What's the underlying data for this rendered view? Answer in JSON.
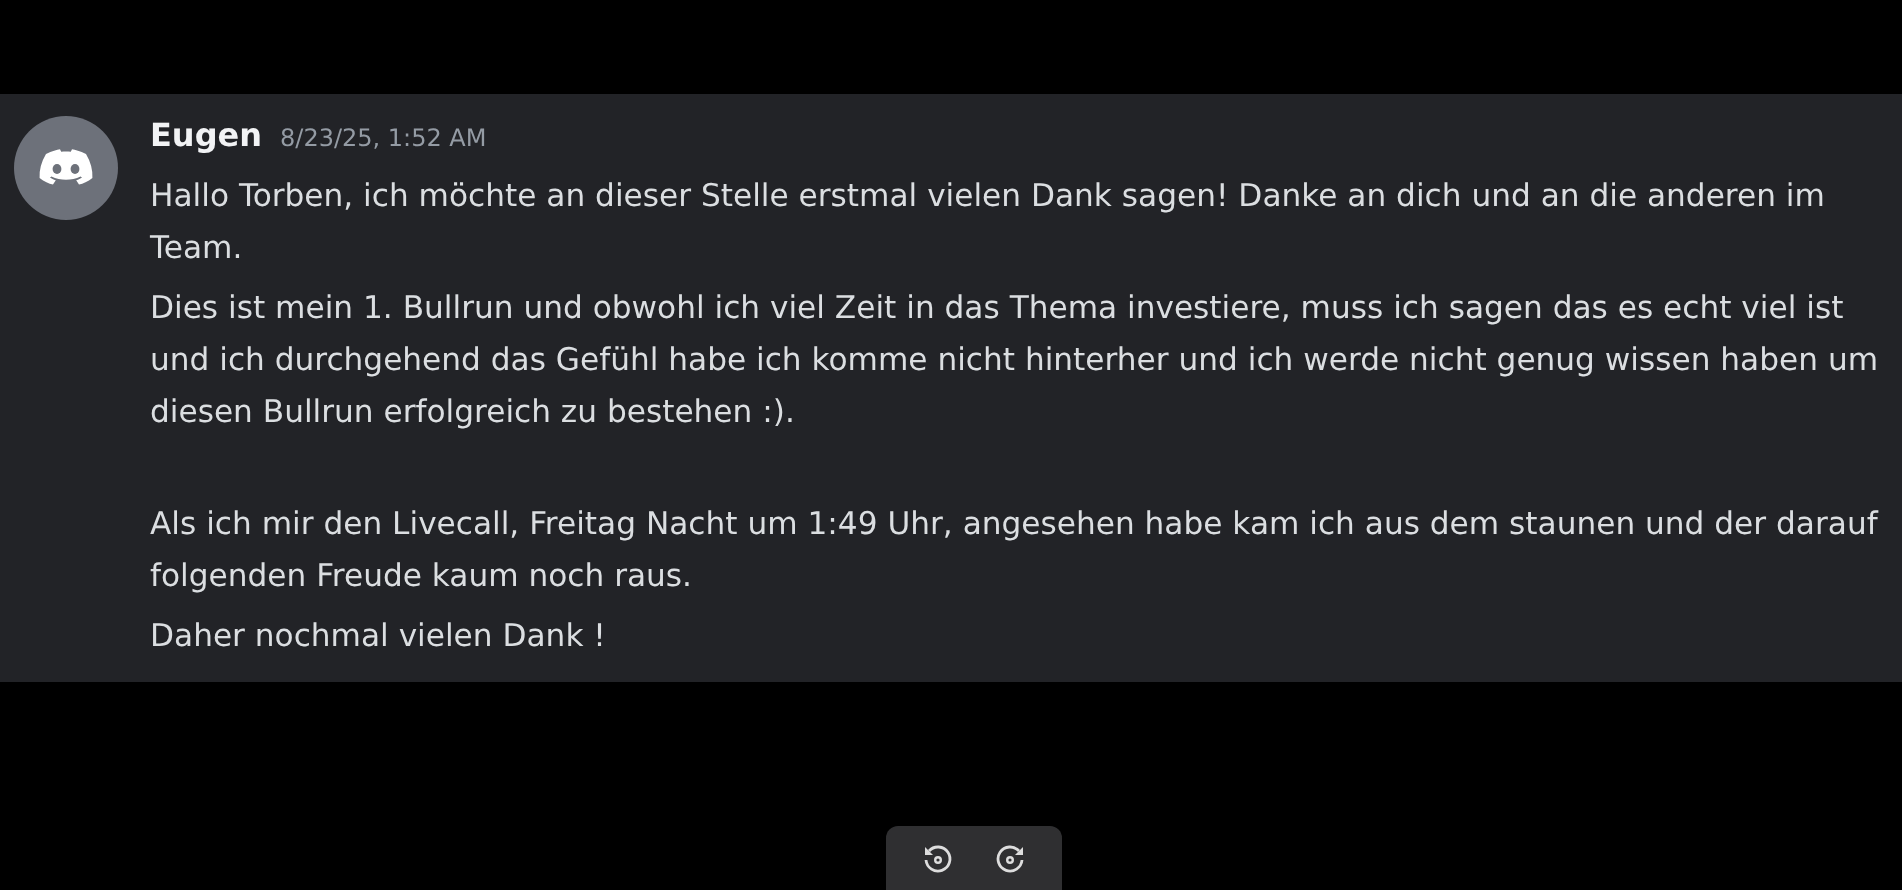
{
  "message": {
    "author": "Eugen",
    "timestamp": "8/23/25, 1:52 AM",
    "blocks": [
      [
        "Hallo Torben, ich möchte an dieser Stelle erstmal vielen Dank sagen! Danke an dich und an die anderen im Team.",
        "Dies ist mein 1. Bullrun und obwohl ich viel Zeit in das Thema investiere, muss ich sagen das es echt viel ist und ich durchgehend das Gefühl habe ich komme nicht hinterher und ich werde nicht genug wissen haben um diesen Bullrun erfolgreich zu bestehen :)."
      ],
      [
        "Als ich mir den Livecall, Freitag Nacht um 1:49 Uhr, angesehen habe kam ich aus dem staunen und der darauf folgenden Freude kaum noch raus.",
        "Daher nochmal vielen Dank !"
      ]
    ]
  }
}
